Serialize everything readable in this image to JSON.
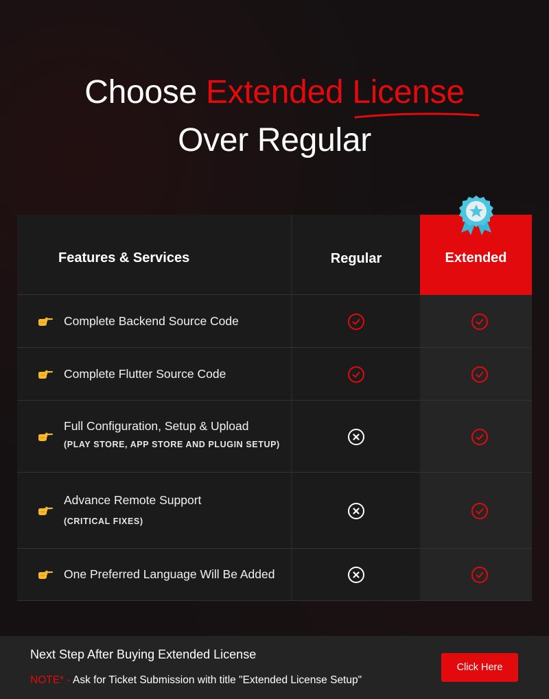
{
  "hero": {
    "title_prefix": "Choose ",
    "title_accent": "Extended License",
    "title_line2": "Over Regular"
  },
  "colors": {
    "accent": "#e30a0d",
    "background": "#151112",
    "table_bg": "#1b1b1b",
    "extended_col_bg": "#252525",
    "footer_bg": "#242424",
    "badge": "#4cc6e0"
  },
  "table": {
    "headers": {
      "features": "Features & Services",
      "regular": "Regular",
      "extended": "Extended"
    },
    "badge_icon": "award-ribbon-star-icon",
    "row_icon": "pointing-hand-icon",
    "rows": [
      {
        "label": "Complete Backend Source Code",
        "sub": "",
        "regular": "check",
        "extended": "check"
      },
      {
        "label": "Complete Flutter Source Code",
        "sub": "",
        "regular": "check",
        "extended": "check"
      },
      {
        "label": "Full Configuration, Setup & Upload",
        "sub": "(PLAY STORE, APP STORE AND PLUGIN SETUP)",
        "regular": "cross",
        "extended": "check"
      },
      {
        "label": "Advance Remote Support",
        "sub": "(CRITICAL FIXES)",
        "regular": "cross",
        "extended": "check"
      },
      {
        "label": "One Preferred Language Will Be Added",
        "sub": "",
        "regular": "cross",
        "extended": "check"
      }
    ]
  },
  "footer": {
    "title": "Next Step After Buying Extended License",
    "note_tag": "NOTE* - ",
    "note_text": "Ask for Ticket Submission with title \"Extended License Setup\"",
    "button_label": "Click Here"
  }
}
